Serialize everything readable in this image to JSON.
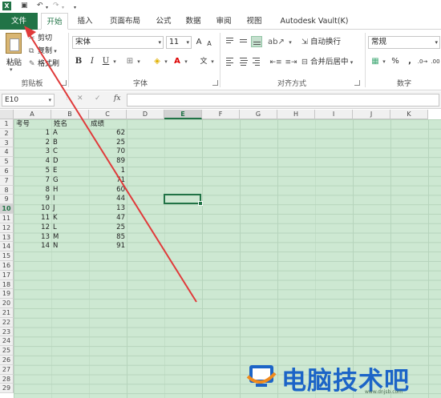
{
  "titlebar": {
    "app_icon": "X",
    "save_icon": "save-icon",
    "undo_icon": "undo-icon",
    "redo_icon": "redo-icon"
  },
  "tabs": [
    {
      "label": "文件"
    },
    {
      "label": "开始"
    },
    {
      "label": "插入"
    },
    {
      "label": "页面布局"
    },
    {
      "label": "公式"
    },
    {
      "label": "数据"
    },
    {
      "label": "审阅"
    },
    {
      "label": "视图"
    },
    {
      "label": "Autodesk Vault(K)"
    }
  ],
  "clipboard": {
    "paste": "粘贴",
    "cut": "剪切",
    "copy": "复制",
    "format_painter": "格式刷",
    "group": "剪贴板"
  },
  "font": {
    "name": "宋体",
    "size": "11",
    "group": "字体",
    "bold": "B",
    "italic": "I",
    "underline": "U",
    "grow": "A",
    "shrink": "A",
    "font_color": "A",
    "phonetic": "文"
  },
  "alignment": {
    "wrap": "自动换行",
    "merge": "合并后居中",
    "group": "对齐方式"
  },
  "number": {
    "format": "常规",
    "percent": "%",
    "comma": ",",
    "group": "数字"
  },
  "formula_bar": {
    "name_box": "E10",
    "cancel": "✕",
    "enter": "✓",
    "fx": "fx",
    "value": ""
  },
  "columns": [
    "A",
    "B",
    "C",
    "D",
    "E",
    "F",
    "G",
    "H",
    "I",
    "J",
    "K"
  ],
  "selected_column": "E",
  "selected_row": "10",
  "rows": [
    "1",
    "2",
    "3",
    "4",
    "5",
    "6",
    "7",
    "8",
    "9",
    "10",
    "11",
    "12",
    "13",
    "14",
    "15",
    "16",
    "17",
    "18",
    "19",
    "20",
    "21",
    "22",
    "23",
    "24",
    "25",
    "26",
    "27",
    "28",
    "29"
  ],
  "headers": {
    "a": "考号",
    "b": "姓名",
    "c": "成绩"
  },
  "records": [
    {
      "id": "1",
      "name": "A",
      "score": "62"
    },
    {
      "id": "2",
      "name": "B",
      "score": "25"
    },
    {
      "id": "3",
      "name": "C",
      "score": "70"
    },
    {
      "id": "4",
      "name": "D",
      "score": "89"
    },
    {
      "id": "5",
      "name": "E",
      "score": "1"
    },
    {
      "id": "7",
      "name": "G",
      "score": "71"
    },
    {
      "id": "8",
      "name": "H",
      "score": "60"
    },
    {
      "id": "9",
      "name": "I",
      "score": "44"
    },
    {
      "id": "10",
      "name": "J",
      "score": "13"
    },
    {
      "id": "11",
      "name": "K",
      "score": "47"
    },
    {
      "id": "12",
      "name": "L",
      "score": "25"
    },
    {
      "id": "13",
      "name": "M",
      "score": "85"
    },
    {
      "id": "14",
      "name": "N",
      "score": "91"
    }
  ],
  "watermark": {
    "text": "电脑技术吧",
    "url": "www.dnjsb.com"
  },
  "colors": {
    "accent": "#217346",
    "grid_bg": "#cde8d2",
    "arrow": "#e03a3a",
    "watermark": "#1c64c7"
  }
}
